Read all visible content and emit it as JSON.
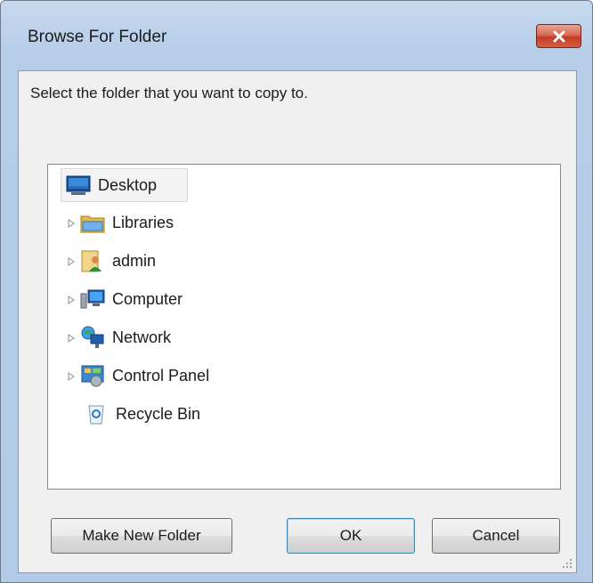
{
  "window": {
    "title": "Browse For Folder",
    "close_icon": "close-icon"
  },
  "prompt": "Select the folder that you want to copy to.",
  "tree": {
    "items": [
      {
        "label": "Desktop",
        "icon": "desktop-icon",
        "expandable": false,
        "selected": true
      },
      {
        "label": "Libraries",
        "icon": "libraries-icon",
        "expandable": true
      },
      {
        "label": "admin",
        "icon": "user-folder-icon",
        "expandable": true
      },
      {
        "label": "Computer",
        "icon": "computer-icon",
        "expandable": true
      },
      {
        "label": "Network",
        "icon": "network-icon",
        "expandable": true
      },
      {
        "label": "Control Panel",
        "icon": "control-panel-icon",
        "expandable": true
      },
      {
        "label": "Recycle Bin",
        "icon": "recycle-bin-icon",
        "expandable": false
      }
    ]
  },
  "buttons": {
    "make_new_folder": "Make New Folder",
    "ok": "OK",
    "cancel": "Cancel"
  }
}
